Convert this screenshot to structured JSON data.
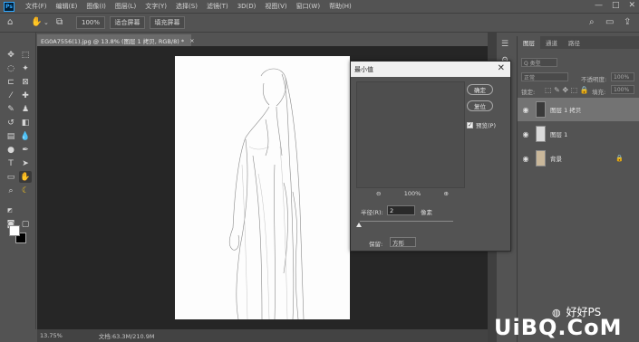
{
  "app": {
    "logo": "Ps"
  },
  "menu": [
    "文件(F)",
    "编辑(E)",
    "图像(I)",
    "图层(L)",
    "文字(Y)",
    "选择(S)",
    "滤镜(T)",
    "3D(D)",
    "视图(V)",
    "窗口(W)",
    "帮助(H)"
  ],
  "window_controls": [
    "—",
    "□",
    "✕"
  ],
  "options": {
    "zoom": "100%",
    "fit_screen": "适合屏幕",
    "fill_screen": "填充屏幕"
  },
  "document": {
    "tab_title": "EG0A7556(1).jpg @ 13.8% (图层 1 拷贝, RGB/8) *",
    "close": "×"
  },
  "status": {
    "zoom": "13.75%",
    "doc_size": "文档:63.3M/210.9M"
  },
  "panel": {
    "tabs": [
      "图层",
      "通道",
      "路径"
    ],
    "kind_placeholder": "Q 类型",
    "blend_mode": "正常",
    "opacity_label": "不透明度:",
    "opacity_value": "100%",
    "lock_label": "锁定:",
    "fill_label": "填充:",
    "fill_value": "100%",
    "layers": [
      {
        "name": "图层 1 拷贝",
        "selected": true
      },
      {
        "name": "图层 1",
        "selected": false
      },
      {
        "name": "背景",
        "selected": false,
        "locked": true
      }
    ]
  },
  "dialog": {
    "title": "最小值",
    "ok": "确定",
    "reset": "复位",
    "preview_label": "预览(P)",
    "zoom": "100%",
    "radius_label": "半径(R):",
    "radius_value": "2",
    "radius_unit": "像素",
    "preserve_label": "保留:",
    "preserve_value": "方形"
  },
  "watermark": {
    "line1": "好好PS",
    "line2": "UiBQ.CoM"
  }
}
